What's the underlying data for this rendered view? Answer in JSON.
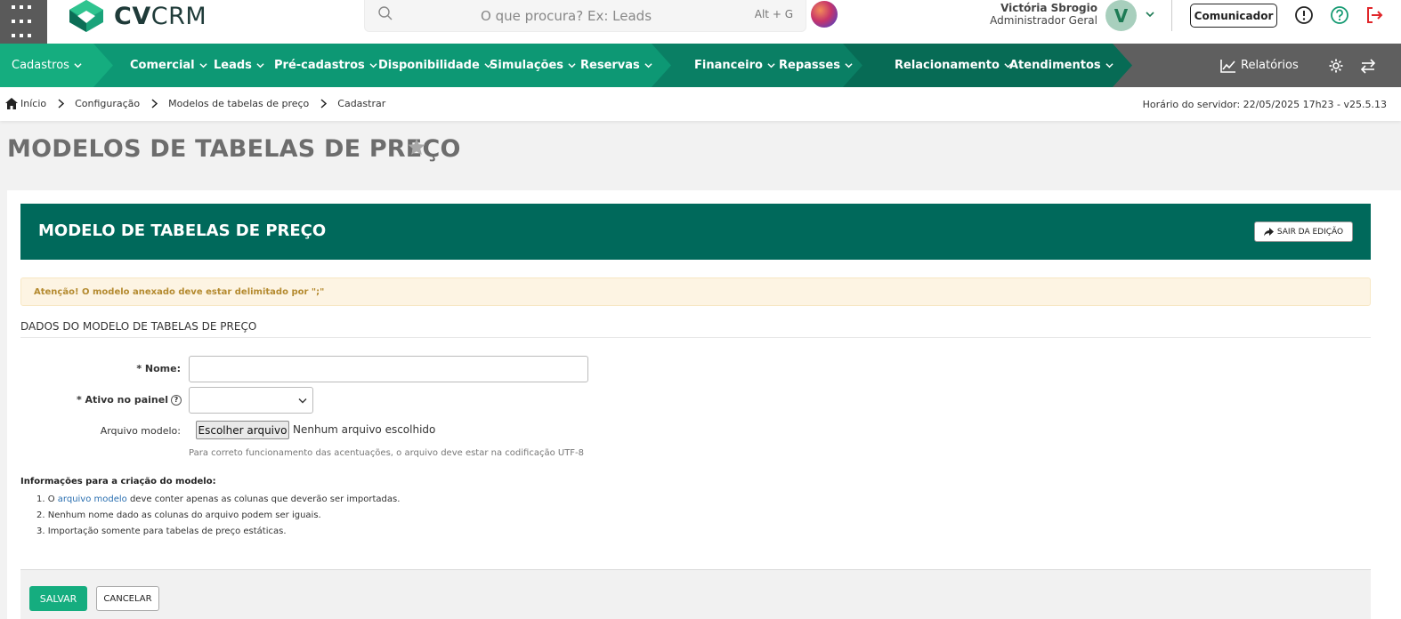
{
  "header": {
    "logo_text_bold": "CV",
    "logo_text_rest": "CRM",
    "search_placeholder": "O que procura? Ex: Leads",
    "search_shortcut": "Alt + G",
    "user_name": "Victória Sbrogio",
    "user_role": "Administrador Geral",
    "avatar_initial": "V",
    "comunicador_label": "Comunicador",
    "icons": [
      "apps-grid-icon",
      "search-icon",
      "info-icon",
      "help-icon",
      "logout-icon"
    ]
  },
  "nav": {
    "items": [
      {
        "label": "Cadastros"
      },
      {
        "label": "Comercial"
      },
      {
        "label": "Leads"
      },
      {
        "label": "Pré-cadastros"
      },
      {
        "label": "Disponibilidade"
      },
      {
        "label": "Simulações"
      },
      {
        "label": "Reservas"
      },
      {
        "label": "Financeiro"
      },
      {
        "label": "Repasses"
      },
      {
        "label": "Relacionamento"
      },
      {
        "label": "Atendimentos"
      }
    ],
    "reports_label": "Relatórios",
    "colors": {
      "seg1": "#15ad7f",
      "seg2": "#0d9874",
      "seg3": "#0a7f64",
      "seg4": "#076b55",
      "rest": "#5f5f5f"
    }
  },
  "breadcrumb": {
    "items": [
      "Início",
      "Configuração",
      "Modelos de tabelas de preço",
      "Cadastrar"
    ],
    "server_time": "Horário do servidor: 22/05/2025 17h23 - v25.5.13"
  },
  "page": {
    "title": "MODELOS DE TABELAS DE PREÇO"
  },
  "card": {
    "title": "MODELO DE TABELAS DE PREÇO",
    "exit_label": "SAIR DA EDIÇÃO",
    "alert": "Atenção! O modelo anexado deve estar delimitado por \";\"",
    "section_title": "DADOS DO MODELO DE TABELAS DE PREÇO",
    "fields": {
      "nome_label": "Nome:",
      "nome_value": "",
      "ativo_label": "Ativo no painel",
      "ativo_value": "",
      "arquivo_label": "Arquivo modelo:",
      "file_button": "Escolher arquivo",
      "file_none": "Nenhum arquivo escolhido",
      "file_help": "Para correto funcionamento das acentuações, o arquivo deve estar na codificação UTF-8"
    },
    "info": {
      "title": "Informações para a criação do modelo:",
      "item1_prefix": "1. O ",
      "item1_link": "arquivo modelo",
      "item1_suffix": " deve conter apenas as colunas que deverão ser importadas.",
      "item2": "2. Nenhum nome dado as colunas do arquivo podem ser iguais.",
      "item3": "3. Importação somente para tabelas de preço estáticas."
    },
    "save_label": "SALVAR",
    "cancel_label": "CANCELAR"
  }
}
